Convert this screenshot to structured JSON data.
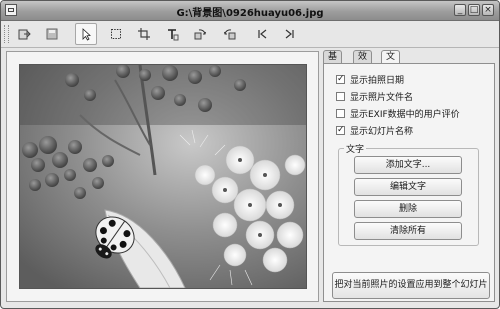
{
  "window": {
    "title": "G:\\背景图\\0926huayu06.jpg",
    "controls": {
      "minimize": "_",
      "maximize": "□",
      "close": "×"
    }
  },
  "toolbar": {
    "tools": [
      {
        "icon": "import-icon",
        "active": false
      },
      {
        "icon": "save-icon",
        "active": false
      },
      {
        "icon": "pointer-icon",
        "active": true
      },
      {
        "icon": "select-rect-icon",
        "active": false
      },
      {
        "icon": "crop-icon",
        "active": false
      },
      {
        "icon": "text-tool-icon",
        "active": false
      },
      {
        "icon": "rotate-right-icon",
        "active": false
      },
      {
        "icon": "rotate-left-icon",
        "active": false
      },
      {
        "icon": "first-icon",
        "active": false
      },
      {
        "icon": "last-icon",
        "active": false
      }
    ]
  },
  "tabs": [
    {
      "label": "基本",
      "selected": false
    },
    {
      "label": "效果",
      "selected": false
    },
    {
      "label": "文字",
      "selected": true
    }
  ],
  "options": [
    {
      "label": "显示拍照日期",
      "checked": true
    },
    {
      "label": "显示照片文件名",
      "checked": false
    },
    {
      "label": "显示EXIF数据中的用户评价",
      "checked": false
    },
    {
      "label": "显示幻灯片名称",
      "checked": true
    }
  ],
  "text_group": {
    "label": "文字",
    "buttons": {
      "add": "添加文字...",
      "edit": "编辑文字",
      "delete": "删除",
      "clear": "清除所有"
    }
  },
  "apply_button": "把对当前照片的设置应用到整个幻灯片",
  "colors": {
    "window_bg": "#e7e7e7",
    "panel_bg": "#f4f4f4",
    "titlebar": "#9d9d9d"
  }
}
